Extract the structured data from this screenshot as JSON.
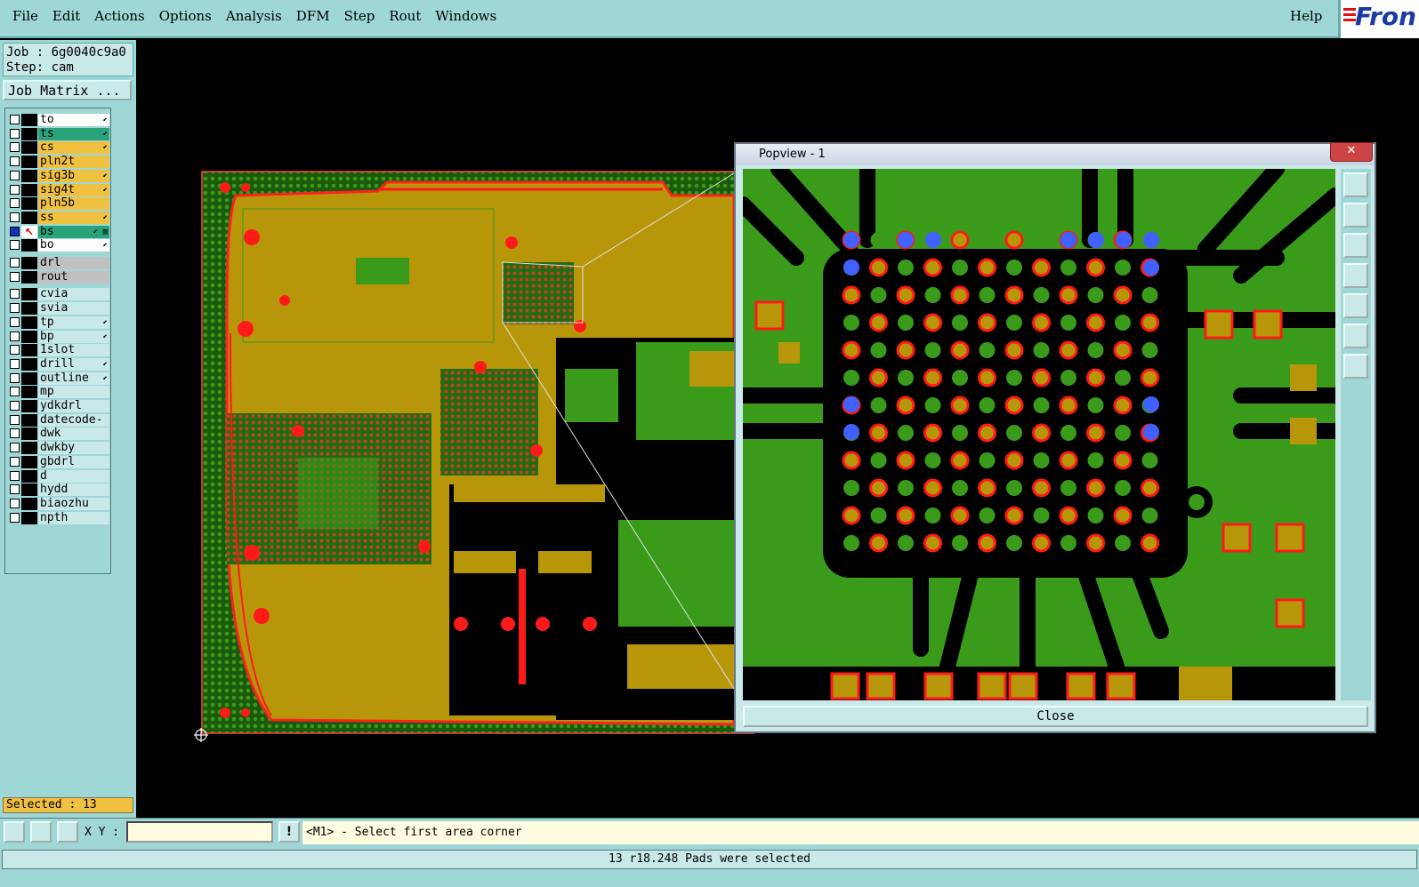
{
  "menu": {
    "items": [
      "File",
      "Edit",
      "Actions",
      "Options",
      "Analysis",
      "DFM",
      "Step",
      "Rout",
      "Windows"
    ],
    "help": "Help",
    "logo_text": "Fron"
  },
  "job": {
    "line1": "Job : 6g0040c9a0",
    "line2": "Step: cam",
    "matrix_button": "Job Matrix ..."
  },
  "layers": [
    {
      "name": "to",
      "color": "#ffffff",
      "mark": "⬋"
    },
    {
      "name": "ts",
      "color": "#2aa37a",
      "mark": "⬋"
    },
    {
      "name": "cs",
      "color": "#f0c040",
      "mark": "⬋"
    },
    {
      "name": "pln2t",
      "color": "#f0c040",
      "mark": ""
    },
    {
      "name": "sig3b",
      "color": "#f0c040",
      "mark": "⬋"
    },
    {
      "name": "sig4t",
      "color": "#f0c040",
      "mark": "⬋"
    },
    {
      "name": "pln5b",
      "color": "#f0c040",
      "mark": ""
    },
    {
      "name": "ss",
      "color": "#f0c040",
      "mark": "⬋"
    },
    {
      "name": "bs",
      "color": "#2aa37a",
      "mark": "⬋ ▥"
    },
    {
      "name": "bo",
      "color": "#ffffff",
      "mark": "⬋"
    },
    {
      "name": "drl",
      "color": "#c0c0c0",
      "mark": ""
    },
    {
      "name": "rout",
      "color": "#c0c0c0",
      "mark": ""
    },
    {
      "name": "cvia",
      "color": "#c9e8e8",
      "mark": ""
    },
    {
      "name": "svia",
      "color": "#c9e8e8",
      "mark": ""
    },
    {
      "name": "tp",
      "color": "#c9e8e8",
      "mark": "⬋"
    },
    {
      "name": "bp",
      "color": "#c9e8e8",
      "mark": "⬋"
    },
    {
      "name": "1slot",
      "color": "#c9e8e8",
      "mark": ""
    },
    {
      "name": "drill",
      "color": "#c9e8e8",
      "mark": "⬋"
    },
    {
      "name": "outline",
      "color": "#c9e8e8",
      "mark": "⬋"
    },
    {
      "name": "mp",
      "color": "#c9e8e8",
      "mark": ""
    },
    {
      "name": "ydkdrl",
      "color": "#c9e8e8",
      "mark": ""
    },
    {
      "name": "datecode-to",
      "color": "#c9e8e8",
      "mark": ""
    },
    {
      "name": "dwk",
      "color": "#c9e8e8",
      "mark": ""
    },
    {
      "name": "dwkby",
      "color": "#c9e8e8",
      "mark": ""
    },
    {
      "name": "gbdrl",
      "color": "#c9e8e8",
      "mark": ""
    },
    {
      "name": "d",
      "color": "#c9e8e8",
      "mark": ""
    },
    {
      "name": "hydd",
      "color": "#c9e8e8",
      "mark": ""
    },
    {
      "name": "biaozhu",
      "color": "#c9e8e8",
      "mark": ""
    },
    {
      "name": "npth",
      "color": "#c9e8e8",
      "mark": ""
    }
  ],
  "selected_text": "Selected : 13",
  "toolbar": {
    "xy_label": "X Y :",
    "xy_value": "",
    "prompt": "<M1> - Select first area corner"
  },
  "status_message": "13 r18.248 Pads were selected",
  "popview": {
    "title": "Popview - 1",
    "close_button": "Close"
  },
  "colors": {
    "panel": "#9fd7d7",
    "board_gold": "#b8960a",
    "board_green": "#3a9a1a",
    "pad_red": "#ff1010",
    "selected_pad": "#4060ff"
  }
}
